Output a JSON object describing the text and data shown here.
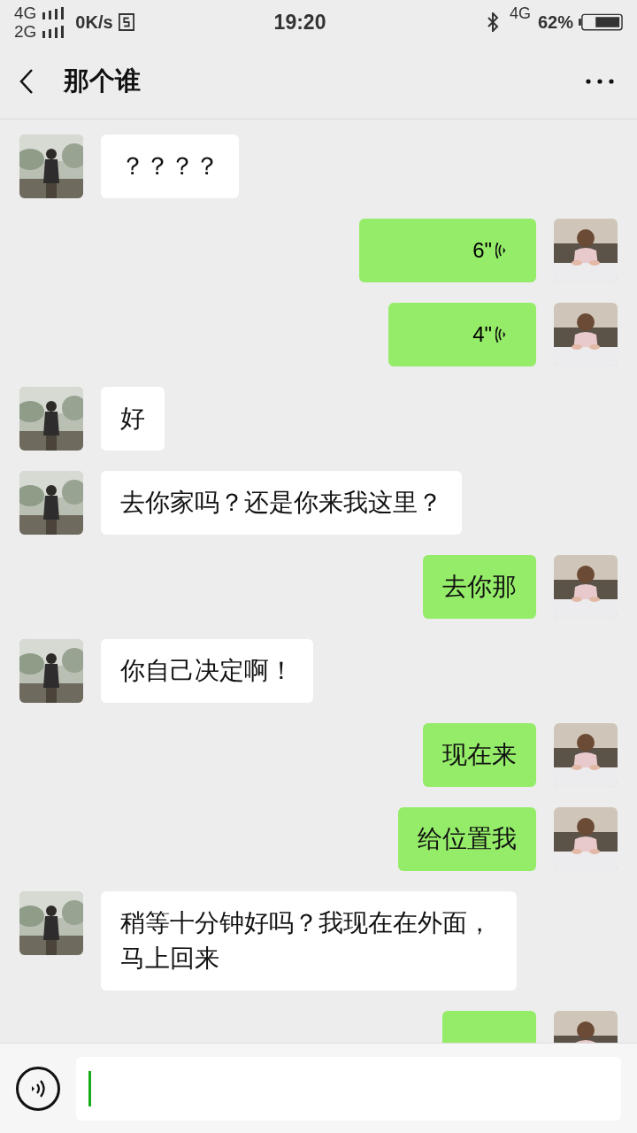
{
  "status_bar": {
    "network_top": "4G",
    "network_bottom": "2G",
    "speed": "0K/s",
    "time": "19:20",
    "data_type": "4G",
    "battery": "62%"
  },
  "header": {
    "title": "那个谁"
  },
  "messages": [
    {
      "outgoing": false,
      "kind": "text",
      "text": "？？？？"
    },
    {
      "outgoing": true,
      "kind": "voice",
      "text": "6\""
    },
    {
      "outgoing": true,
      "kind": "voice",
      "text": "4\""
    },
    {
      "outgoing": false,
      "kind": "text",
      "text": "好"
    },
    {
      "outgoing": false,
      "kind": "text",
      "text": "去你家吗？还是你来我这里？"
    },
    {
      "outgoing": true,
      "kind": "text",
      "text": "去你那"
    },
    {
      "outgoing": false,
      "kind": "text",
      "text": "你自己决定啊！"
    },
    {
      "outgoing": true,
      "kind": "text",
      "text": "现在来"
    },
    {
      "outgoing": true,
      "kind": "text",
      "text": "给位置我"
    },
    {
      "outgoing": false,
      "kind": "text",
      "text": "稍等十分钟好吗？我现在在外面，马上回来"
    },
    {
      "outgoing": true,
      "kind": "partial"
    }
  ]
}
